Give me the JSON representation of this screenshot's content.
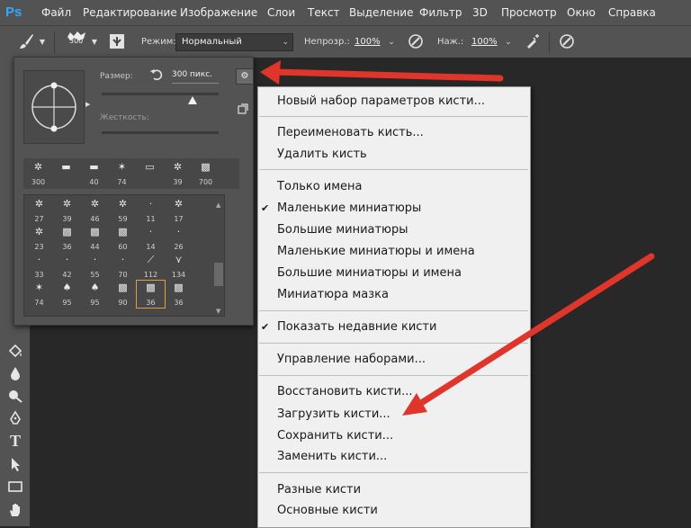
{
  "app": {
    "logo": "Ps",
    "brand_color": "#31a8ff",
    "accent_arrow_color": "#e0352b"
  },
  "menubar": {
    "items": [
      "Файл",
      "Редактирование",
      "Изображение",
      "Слои",
      "Текст",
      "Выделение",
      "Фильтр",
      "3D",
      "Просмотр",
      "Окно",
      "Справка"
    ]
  },
  "options_bar": {
    "brush_size_value": "300",
    "mode_label": "Режим:",
    "mode_value": "Нормальный",
    "opacity_label": "Непрозр.:",
    "opacity_value": "100%",
    "flow_label": "Наж.:",
    "flow_value": "100%"
  },
  "brush_panel": {
    "size_label": "Размер:",
    "size_value": "300 пикс.",
    "hardness_label": "Жесткость:",
    "recent_brushes": [
      "300",
      "",
      "40",
      "74",
      "",
      "39",
      "700"
    ],
    "grid_rows": [
      [
        "27",
        "39",
        "46",
        "59",
        "11",
        "17"
      ],
      [
        "23",
        "36",
        "44",
        "60",
        "14",
        "26"
      ],
      [
        "33",
        "42",
        "55",
        "70",
        "112",
        "134"
      ],
      [
        "74",
        "95",
        "95",
        "90",
        "36",
        "36"
      ]
    ]
  },
  "dropdown": {
    "groups": [
      [
        {
          "label": "Новый набор параметров кисти...",
          "checked": false
        }
      ],
      [
        {
          "label": "Переименовать кисть...",
          "checked": false
        },
        {
          "label": "Удалить кисть",
          "checked": false
        }
      ],
      [
        {
          "label": "Только имена",
          "checked": false
        },
        {
          "label": "Маленькие миниатюры",
          "checked": true
        },
        {
          "label": "Большие миниатюры",
          "checked": false
        },
        {
          "label": "Маленькие миниатюры и имена",
          "checked": false
        },
        {
          "label": "Большие миниатюры и имена",
          "checked": false
        },
        {
          "label": "Миниатюра мазка",
          "checked": false
        }
      ],
      [
        {
          "label": "Показать недавние кисти",
          "checked": true
        }
      ],
      [
        {
          "label": "Управление наборами...",
          "checked": false
        }
      ],
      [
        {
          "label": "Восстановить кисти...",
          "checked": false
        },
        {
          "label": "Загрузить кисти...",
          "checked": false
        },
        {
          "label": "Сохранить кисти...",
          "checked": false
        },
        {
          "label": "Заменить кисти...",
          "checked": false
        }
      ],
      [
        {
          "label": "Разные кисти",
          "checked": false
        },
        {
          "label": "Основные кисти",
          "checked": false
        }
      ]
    ]
  }
}
